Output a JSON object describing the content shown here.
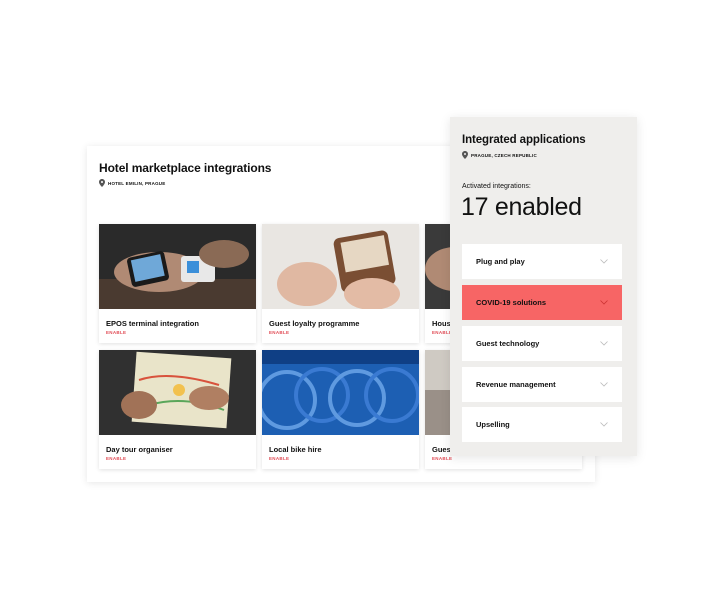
{
  "marketplace": {
    "title": "Hotel marketplace integrations",
    "location": "HOTEL EMILIN, PRAGUE",
    "cards": [
      {
        "name": "EPOS terminal integration",
        "action": "ENABLE"
      },
      {
        "name": "Guest loyalty programme",
        "action": "ENABLE"
      },
      {
        "name": "Hous",
        "action": "ENABLE"
      },
      {
        "name": "Day tour organiser",
        "action": "ENABLE"
      },
      {
        "name": "Local bike hire",
        "action": "ENABLE"
      },
      {
        "name": "Gues",
        "action": "ENABLE"
      }
    ]
  },
  "panel": {
    "title": "Integrated applications",
    "location": "PRAGUE, CZECH REPUBLIC",
    "activated_label": "Activated integrations:",
    "activated_value": "17 enabled",
    "categories": [
      {
        "label": "Plug and play"
      },
      {
        "label": "COVID-19 solutions"
      },
      {
        "label": "Guest technology"
      },
      {
        "label": "Revenue management"
      },
      {
        "label": "Upselling"
      }
    ],
    "active_category": "COVID-19 solutions"
  },
  "colors": {
    "accent": "#f76565",
    "enable_text": "#e14b55",
    "panel_bg": "#efeeec"
  }
}
